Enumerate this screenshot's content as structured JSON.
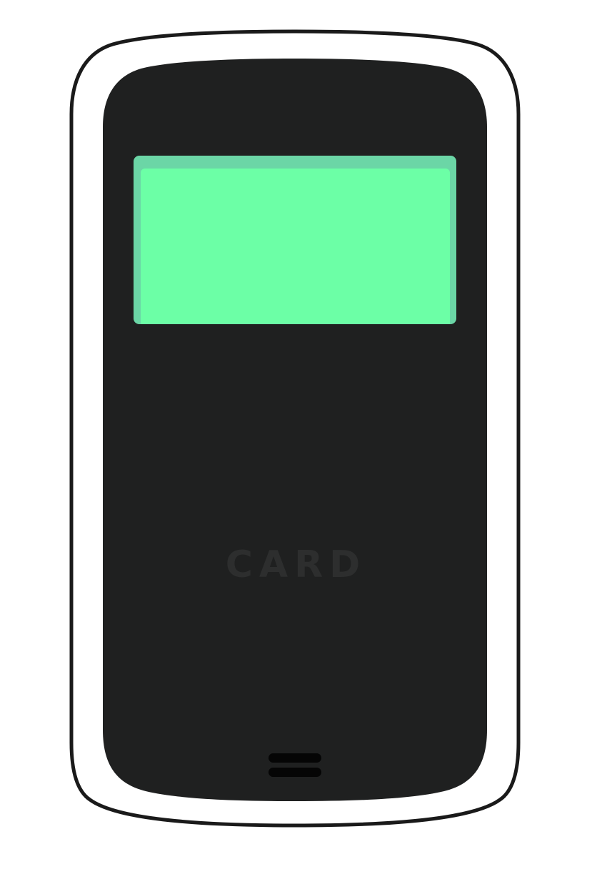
{
  "device": {
    "card_label": "CARD"
  },
  "colors": {
    "background": "#ffffff",
    "outline": "#1a1a1a",
    "body": "#1f2020",
    "screen_bezel": "#6bd6a6",
    "screen": "#6cffa6",
    "label": "#2d2e2e",
    "speaker": "#050505"
  },
  "icons": {
    "speaker": "speaker-grille-icon"
  }
}
